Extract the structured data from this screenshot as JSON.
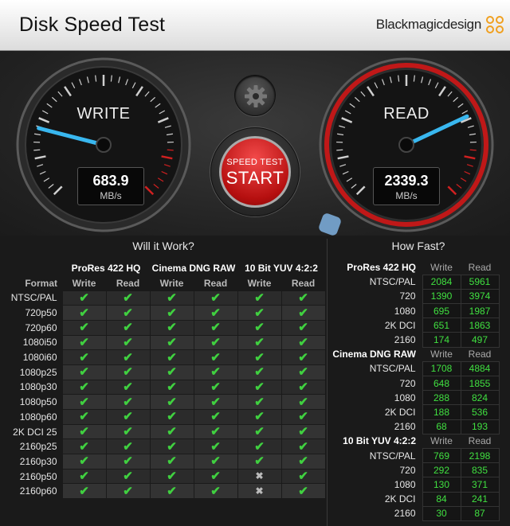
{
  "app": {
    "title": "Disk Speed Test",
    "brand": "Blackmagicdesign"
  },
  "gauges": {
    "write": {
      "label": "WRITE",
      "value": "683.9",
      "unit": "MB/s",
      "needle_fraction": 0.22
    },
    "read": {
      "label": "READ",
      "value": "2339.3",
      "unit": "MB/s",
      "needle_fraction": 0.74
    }
  },
  "controls": {
    "settings_icon": "gear-icon",
    "start_sub": "SPEED TEST",
    "start_main": "START"
  },
  "will_it_work": {
    "heading": "Will it Work?",
    "format_label": "Format",
    "groups": [
      "ProRes 422 HQ",
      "Cinema DNG RAW",
      "10 Bit YUV 4:2:2"
    ],
    "write_label": "Write",
    "read_label": "Read",
    "rows": [
      {
        "format": "NTSC/PAL",
        "cells": [
          "ok",
          "ok",
          "ok",
          "ok",
          "ok",
          "ok"
        ]
      },
      {
        "format": "720p50",
        "cells": [
          "ok",
          "ok",
          "ok",
          "ok",
          "ok",
          "ok"
        ]
      },
      {
        "format": "720p60",
        "cells": [
          "ok",
          "ok",
          "ok",
          "ok",
          "ok",
          "ok"
        ]
      },
      {
        "format": "1080i50",
        "cells": [
          "ok",
          "ok",
          "ok",
          "ok",
          "ok",
          "ok"
        ]
      },
      {
        "format": "1080i60",
        "cells": [
          "ok",
          "ok",
          "ok",
          "ok",
          "ok",
          "ok"
        ]
      },
      {
        "format": "1080p25",
        "cells": [
          "ok",
          "ok",
          "ok",
          "ok",
          "ok",
          "ok"
        ]
      },
      {
        "format": "1080p30",
        "cells": [
          "ok",
          "ok",
          "ok",
          "ok",
          "ok",
          "ok"
        ]
      },
      {
        "format": "1080p50",
        "cells": [
          "ok",
          "ok",
          "ok",
          "ok",
          "ok",
          "ok"
        ]
      },
      {
        "format": "1080p60",
        "cells": [
          "ok",
          "ok",
          "ok",
          "ok",
          "ok",
          "ok"
        ]
      },
      {
        "format": "2K DCI 25",
        "cells": [
          "ok",
          "ok",
          "ok",
          "ok",
          "ok",
          "ok"
        ]
      },
      {
        "format": "2160p25",
        "cells": [
          "ok",
          "ok",
          "ok",
          "ok",
          "ok",
          "ok"
        ]
      },
      {
        "format": "2160p30",
        "cells": [
          "ok",
          "ok",
          "ok",
          "ok",
          "ok",
          "ok"
        ]
      },
      {
        "format": "2160p50",
        "cells": [
          "ok",
          "ok",
          "ok",
          "ok",
          "no",
          "ok"
        ]
      },
      {
        "format": "2160p60",
        "cells": [
          "ok",
          "ok",
          "ok",
          "ok",
          "no",
          "ok"
        ]
      }
    ]
  },
  "how_fast": {
    "heading": "How Fast?",
    "write_label": "Write",
    "read_label": "Read",
    "groups": [
      {
        "name": "ProRes 422 HQ",
        "rows": [
          {
            "format": "NTSC/PAL",
            "write": "2084",
            "read": "5961"
          },
          {
            "format": "720",
            "write": "1390",
            "read": "3974"
          },
          {
            "format": "1080",
            "write": "695",
            "read": "1987"
          },
          {
            "format": "2K DCI",
            "write": "651",
            "read": "1863"
          },
          {
            "format": "2160",
            "write": "174",
            "read": "497"
          }
        ]
      },
      {
        "name": "Cinema DNG RAW",
        "rows": [
          {
            "format": "NTSC/PAL",
            "write": "1708",
            "read": "4884"
          },
          {
            "format": "720",
            "write": "648",
            "read": "1855"
          },
          {
            "format": "1080",
            "write": "288",
            "read": "824"
          },
          {
            "format": "2K DCI",
            "write": "188",
            "read": "536"
          },
          {
            "format": "2160",
            "write": "68",
            "read": "193"
          }
        ]
      },
      {
        "name": "10 Bit YUV 4:2:2",
        "rows": [
          {
            "format": "NTSC/PAL",
            "write": "769",
            "read": "2198"
          },
          {
            "format": "720",
            "write": "292",
            "read": "835"
          },
          {
            "format": "1080",
            "write": "130",
            "read": "371"
          },
          {
            "format": "2K DCI",
            "write": "84",
            "read": "241"
          },
          {
            "format": "2160",
            "write": "30",
            "read": "87"
          }
        ]
      }
    ]
  },
  "colors": {
    "ok": "#40d040",
    "start": "#d01818",
    "read_ring": "#c01818",
    "needle": "#39b7ef"
  }
}
